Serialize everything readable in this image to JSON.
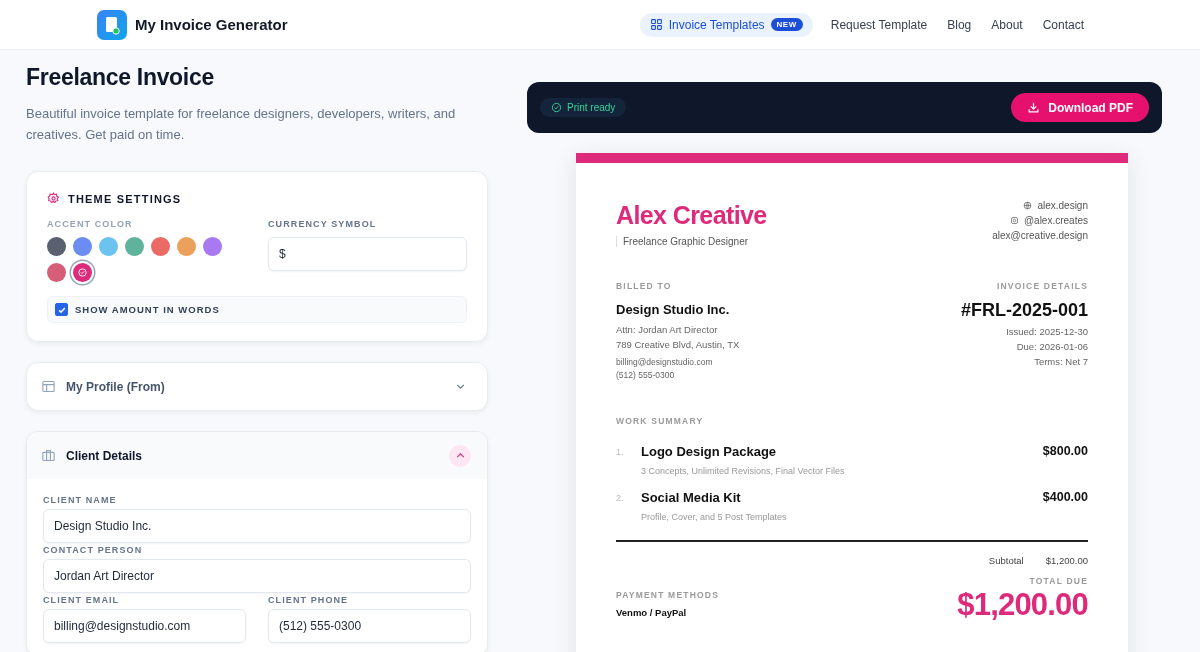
{
  "header": {
    "app_name": "My Invoice Generator",
    "nav": [
      {
        "label": "Invoice Templates",
        "selected": true,
        "badge": "NEW"
      },
      {
        "label": "Request Template",
        "selected": false
      },
      {
        "label": "Blog",
        "selected": false
      },
      {
        "label": "About",
        "selected": false
      },
      {
        "label": "Contact",
        "selected": false
      }
    ]
  },
  "page": {
    "title": "Freelance Invoice",
    "description": "Beautiful invoice template for freelance designers, developers, writers, and creatives. Get paid on time."
  },
  "theme_settings": {
    "title": "THEME SETTINGS",
    "accent_label": "ACCENT COLOR",
    "swatches": [
      {
        "color": "#5b6070",
        "selected": false
      },
      {
        "color": "#6b8cf0",
        "selected": false
      },
      {
        "color": "#6cc3ef",
        "selected": false
      },
      {
        "color": "#5fb39d",
        "selected": false
      },
      {
        "color": "#ec6a64",
        "selected": false
      },
      {
        "color": "#eba05c",
        "selected": false
      },
      {
        "color": "#a879f0",
        "selected": false
      },
      {
        "color": "#d65e78",
        "selected": false
      },
      {
        "color": "#dd2a7b",
        "selected": true
      }
    ],
    "currency_label": "CURRENCY SYMBOL",
    "currency_value": "$",
    "show_words": {
      "label": "SHOW AMOUNT IN WORDS",
      "checked": true
    }
  },
  "sections": [
    {
      "title": "My Profile (From)",
      "expanded": false
    },
    {
      "title": "Client Details",
      "expanded": true,
      "fields": [
        {
          "kind": "full",
          "label": "CLIENT NAME",
          "value": "Design Studio Inc."
        },
        {
          "kind": "full",
          "label": "CONTACT PERSON",
          "value": "Jordan Art Director"
        },
        {
          "kind": "half",
          "label": "CLIENT EMAIL",
          "value": "billing@designstudio.com"
        },
        {
          "kind": "half",
          "label": "CLIENT PHONE",
          "value": "(512) 555-0300"
        }
      ]
    }
  ],
  "preview_bar": {
    "status": "Print ready",
    "button": "Download PDF"
  },
  "invoice": {
    "name": "Alex Creative",
    "tagline": "Freelance Graphic Designer",
    "contacts": [
      {
        "kind": "web",
        "text": "alex.design"
      },
      {
        "kind": "instagram",
        "text": "@alex.creates"
      },
      {
        "kind": "email",
        "text": "alex@creative.design"
      }
    ],
    "billed_to": {
      "label": "BILLED TO",
      "name": "Design Studio Inc.",
      "lines": [
        "Attn: Jordan Art Director",
        "789 Creative Blvd, Austin, TX"
      ],
      "contact": [
        "billing@designstudio.com",
        "(512) 555-0300"
      ]
    },
    "details": {
      "label": "INVOICE DETAILS",
      "number": "#FRL-2025-001",
      "lines": [
        "Issued: 2025-12-30",
        "Due: 2026-01-06",
        "Terms: Net 7"
      ]
    },
    "work_label": "WORK SUMMARY",
    "items": [
      {
        "number": "1.",
        "name": "Logo Design Package",
        "description": "3 Concepts, Unlimited Revisions, Final Vector Files",
        "amount": "$800.00"
      },
      {
        "number": "2.",
        "name": "Social Media Kit",
        "description": "Profile, Cover, and 5 Post Templates",
        "amount": "$400.00"
      }
    ],
    "subtotal_label": "Subtotal",
    "subtotal": "$1,200.00",
    "total_label": "TOTAL DUE",
    "total": "$1,200.00",
    "payment_label": "PAYMENT METHODS",
    "payment_method": "Venmo / PayPal"
  }
}
